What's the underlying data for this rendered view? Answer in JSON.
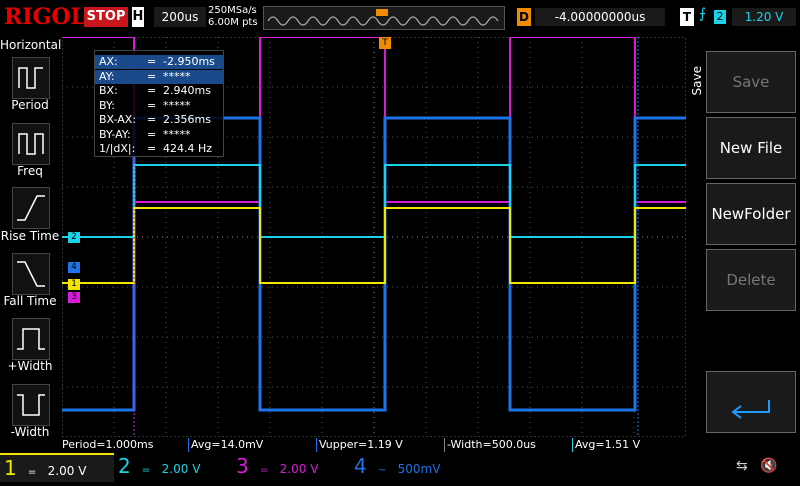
{
  "brand": "RIGOL",
  "run_state": "STOP",
  "timebase": {
    "label": "H",
    "value": "200us",
    "sample_rate": "250MSa/s",
    "memory": "6.00M pts"
  },
  "delay": {
    "label": "D",
    "value": "-4.00000000us"
  },
  "trigger": {
    "label": "T",
    "source": "2",
    "level": "1.20 V"
  },
  "left_menu": {
    "title": "Horizontal",
    "items": [
      "Period",
      "Freq",
      "Rise Time",
      "Fall Time",
      "+Width",
      "-Width"
    ]
  },
  "cursors": [
    {
      "key": "AX:",
      "value": "-2.950ms",
      "selected": true
    },
    {
      "key": "AY:",
      "value": "*****",
      "selected": true
    },
    {
      "key": "BX:",
      "value": "2.940ms",
      "selected": false
    },
    {
      "key": "BY:",
      "value": "*****",
      "selected": false
    },
    {
      "key": "BX-AX:",
      "value": "2.356ms",
      "selected": false
    },
    {
      "key": "BY-AY:",
      "value": "*****",
      "selected": false
    },
    {
      "key": "1/|dX|:",
      "value": "424.4 Hz",
      "selected": false
    }
  ],
  "right_menu": {
    "title": "Save",
    "buttons": [
      {
        "label": "Save",
        "enabled": false
      },
      {
        "label": "New File",
        "enabled": true
      },
      {
        "label": "NewFolder",
        "enabled": true
      },
      {
        "label": "Delete",
        "enabled": false
      },
      {
        "label": "",
        "enabled": true
      }
    ]
  },
  "measurements": [
    {
      "text": "Period=1.000ms",
      "color": "#f2e600"
    },
    {
      "text": "Avg=14.0mV",
      "color": "#1e73e8"
    },
    {
      "text": "Vupper=1.19 V",
      "color": "#1e73e8"
    },
    {
      "text": "-Width=500.0us",
      "color": "#ffffff"
    },
    {
      "text": "Avg=1.51 V",
      "color": "#1bd3e8"
    }
  ],
  "channels": [
    {
      "num": "1",
      "coupling": "=",
      "scale": "2.00 V",
      "color": "#f2e600"
    },
    {
      "num": "2",
      "coupling": "=",
      "scale": "2.00 V",
      "color": "#1bd3e8"
    },
    {
      "num": "3",
      "coupling": "=",
      "scale": "2.00 V",
      "color": "#d81bd8"
    },
    {
      "num": "4",
      "coupling": "~",
      "scale": "500mV",
      "color": "#1e73e8"
    }
  ],
  "waveforms": {
    "ch1": {
      "color": "#f2e600",
      "marker": "1"
    },
    "ch2": {
      "color": "#1bd3e8",
      "marker": "2"
    },
    "ch3": {
      "color": "#d81bd8",
      "marker": "3"
    },
    "ch4": {
      "color": "#1e73e8",
      "marker": "4"
    }
  },
  "markers": {
    "trigger_pos": "T",
    "trigger_level": "T"
  }
}
